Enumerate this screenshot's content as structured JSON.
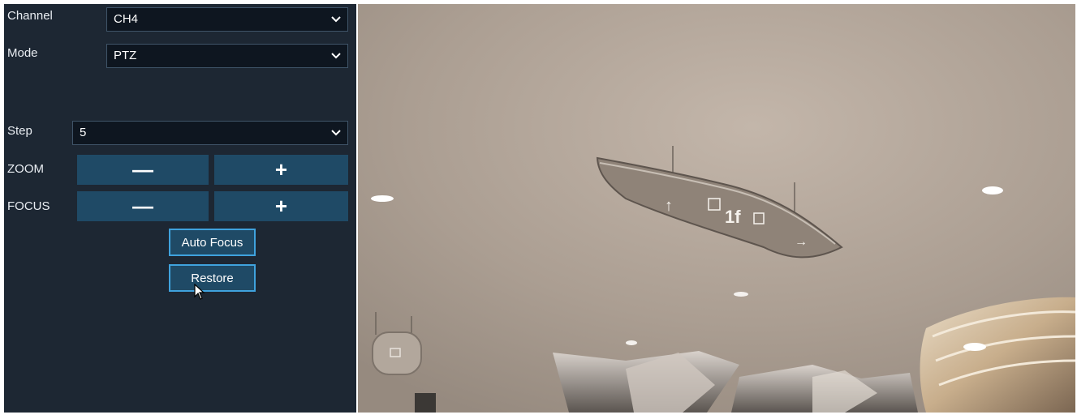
{
  "channel": {
    "label": "Channel",
    "value": "CH4"
  },
  "mode": {
    "label": "Mode",
    "value": "PTZ"
  },
  "step": {
    "label": "Step",
    "value": "5"
  },
  "zoom": {
    "label": "ZOOM",
    "minus": "—",
    "plus": "+"
  },
  "focus": {
    "label": "FOCUS",
    "minus": "—",
    "plus": "+"
  },
  "buttons": {
    "auto_focus": "Auto Focus",
    "restore": "Restore"
  },
  "sign": {
    "text": "1f"
  },
  "colors": {
    "panel_bg": "#1d2733",
    "button_bg": "#1f4a66",
    "button_border": "#3fa2dd",
    "select_bg": "#0e1620"
  },
  "icons": {
    "dropdown": "chevron-down-icon",
    "cursor": "mouse-pointer-icon"
  }
}
